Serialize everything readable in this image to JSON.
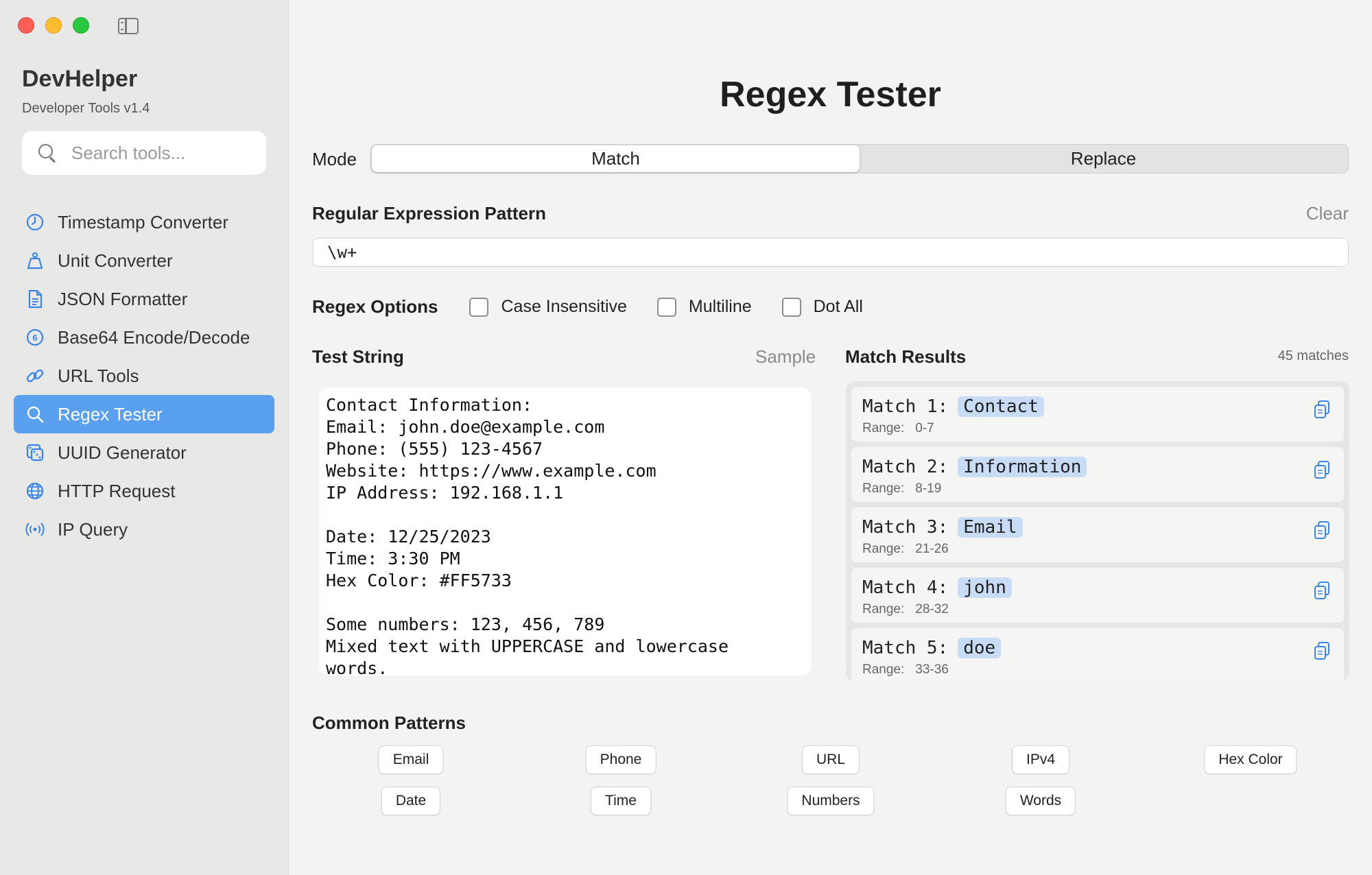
{
  "sidebar": {
    "app_title": "DevHelper",
    "app_subtitle": "Developer Tools v1.4",
    "search_placeholder": "Search tools...",
    "items": [
      {
        "label": "Timestamp Converter",
        "icon": "clock-icon",
        "active": false
      },
      {
        "label": "Unit Converter",
        "icon": "scale-icon",
        "active": false
      },
      {
        "label": "JSON Formatter",
        "icon": "document-icon",
        "active": false
      },
      {
        "label": "Base64 Encode/Decode",
        "icon": "number-six-circle-icon",
        "active": false
      },
      {
        "label": "URL Tools",
        "icon": "link-icon",
        "active": false
      },
      {
        "label": "Regex Tester",
        "icon": "search-icon",
        "active": true
      },
      {
        "label": "UUID Generator",
        "icon": "dice-icon",
        "active": false
      },
      {
        "label": "HTTP Request",
        "icon": "globe-icon",
        "active": false
      },
      {
        "label": "IP Query",
        "icon": "antenna-icon",
        "active": false
      }
    ]
  },
  "main": {
    "title": "Regex Tester",
    "mode_label": "Mode",
    "modes": [
      "Match",
      "Replace"
    ],
    "active_mode": "Match",
    "pattern_label": "Regular Expression Pattern",
    "clear_label": "Clear",
    "pattern_value": "\\w+",
    "options_label": "Regex Options",
    "options": [
      {
        "label": "Case Insensitive",
        "checked": false
      },
      {
        "label": "Multiline",
        "checked": false
      },
      {
        "label": "Dot All",
        "checked": false
      }
    ],
    "test_label": "Test String",
    "sample_label": "Sample",
    "test_string": "Contact Information:\nEmail: john.doe@example.com\nPhone: (555) 123-4567\nWebsite: https://www.example.com\nIP Address: 192.168.1.1\n\nDate: 12/25/2023\nTime: 3:30 PM\nHex Color: #FF5733\n\nSome numbers: 123, 456, 789\nMixed text with UPPERCASE and lowercase\nwords.",
    "results_label": "Match Results",
    "match_count": "45 matches",
    "range_label": "Range:",
    "matches": [
      {
        "num": "Match 1:",
        "value": "Contact",
        "range": "0-7"
      },
      {
        "num": "Match 2:",
        "value": "Information",
        "range": "8-19"
      },
      {
        "num": "Match 3:",
        "value": "Email",
        "range": "21-26"
      },
      {
        "num": "Match 4:",
        "value": "john",
        "range": "28-32"
      },
      {
        "num": "Match 5:",
        "value": "doe",
        "range": "33-36"
      }
    ],
    "common_label": "Common Patterns",
    "common_patterns": [
      "Email",
      "Phone",
      "URL",
      "IPv4",
      "Hex Color",
      "Date",
      "Time",
      "Numbers",
      "Words"
    ]
  },
  "colors": {
    "accent": "#5aa0f0",
    "match_highlight": "#c8dcf6",
    "icon_blue": "#3a86e8"
  }
}
